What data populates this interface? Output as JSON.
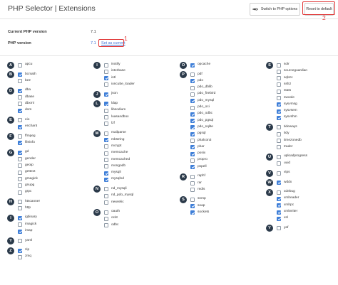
{
  "header": {
    "title": "PHP Selector | Extensions",
    "switch_label": "Switch to PHP options",
    "reset_label": "Reset to default"
  },
  "annotations": {
    "one": "1",
    "two": "2"
  },
  "info": {
    "current_label": "Current PHP version",
    "current_value": "7.1",
    "php_label": "PHP version",
    "php_value": "7.1",
    "set_current": "Set as current"
  },
  "columns": [
    [
      {
        "letter": "A",
        "items": [
          {
            "n": "apcu",
            "c": false
          }
        ]
      },
      {
        "letter": "B",
        "items": [
          {
            "n": "bcmath",
            "c": true
          },
          {
            "n": "bz2",
            "c": false
          }
        ]
      },
      {
        "letter": "D",
        "items": [
          {
            "n": "dba",
            "c": true
          },
          {
            "n": "dbase",
            "c": false
          },
          {
            "n": "dbxml",
            "c": false
          },
          {
            "n": "dom",
            "c": true
          }
        ]
      },
      {
        "letter": "E",
        "items": [
          {
            "n": "eio",
            "c": false
          },
          {
            "n": "enchant",
            "c": true
          }
        ]
      },
      {
        "letter": "F",
        "items": [
          {
            "n": "ffmpeg",
            "c": false
          },
          {
            "n": "fileinfo",
            "c": true
          }
        ]
      },
      {
        "letter": "G",
        "items": [
          {
            "n": "gd",
            "c": true
          },
          {
            "n": "gender",
            "c": false
          },
          {
            "n": "geoip",
            "c": false
          },
          {
            "n": "gettext",
            "c": false
          },
          {
            "n": "gmagick",
            "c": false
          },
          {
            "n": "gnupg",
            "c": false
          },
          {
            "n": "grpc",
            "c": false
          }
        ]
      },
      {
        "letter": "H",
        "items": [
          {
            "n": "htscanner",
            "c": false
          },
          {
            "n": "http",
            "c": false
          }
        ]
      },
      {
        "letter": "I",
        "items": [
          {
            "n": "igbinary",
            "c": true
          },
          {
            "n": "imagick",
            "c": false
          },
          {
            "n": "imap",
            "c": true
          }
        ]
      },
      {
        "letter": "Y",
        "items": [
          {
            "n": "yaml",
            "c": false
          }
        ]
      },
      {
        "letter": "Z",
        "items": [
          {
            "n": "zip",
            "c": true
          },
          {
            "n": "zmq",
            "c": false
          }
        ]
      }
    ],
    [
      {
        "letter": "I",
        "items": [
          {
            "n": "inotify",
            "c": false
          },
          {
            "n": "interbase",
            "c": false
          },
          {
            "n": "intl",
            "c": true
          },
          {
            "n": "ioncube_loader",
            "c": false
          }
        ]
      },
      {
        "letter": "J",
        "items": [
          {
            "n": "json",
            "c": true
          }
        ]
      },
      {
        "letter": "L",
        "items": [
          {
            "n": "ldap",
            "c": true
          },
          {
            "n": "libsodium",
            "c": false
          },
          {
            "n": "luasandbox",
            "c": false
          },
          {
            "n": "lzf",
            "c": false
          }
        ]
      },
      {
        "letter": "M",
        "items": [
          {
            "n": "mailparse",
            "c": false
          },
          {
            "n": "mbstring",
            "c": true
          },
          {
            "n": "mcrypt",
            "c": false
          },
          {
            "n": "memcache",
            "c": false
          },
          {
            "n": "memcached",
            "c": false
          },
          {
            "n": "mongodb",
            "c": false
          },
          {
            "n": "mysqli",
            "c": true
          },
          {
            "n": "mysqlnd",
            "c": true
          }
        ]
      },
      {
        "letter": "N",
        "items": [
          {
            "n": "nd_mysqli",
            "c": false
          },
          {
            "n": "nd_pdo_mysql",
            "c": false
          },
          {
            "n": "newrelic",
            "c": false
          }
        ]
      },
      {
        "letter": "O",
        "items": [
          {
            "n": "oauth",
            "c": false
          },
          {
            "n": "oci8",
            "c": false
          },
          {
            "n": "odbc",
            "c": false
          }
        ]
      }
    ],
    [
      {
        "letter": "O",
        "items": [
          {
            "n": "opcache",
            "c": true
          }
        ]
      },
      {
        "letter": "P",
        "items": [
          {
            "n": "pdf",
            "c": false
          },
          {
            "n": "pdo",
            "c": true
          },
          {
            "n": "pdo_dblib",
            "c": false
          },
          {
            "n": "pdo_firebird",
            "c": false
          },
          {
            "n": "pdo_mysql",
            "c": true
          },
          {
            "n": "pdo_oci",
            "c": false
          },
          {
            "n": "pdo_odbc",
            "c": true
          },
          {
            "n": "pdo_pgsql",
            "c": true
          },
          {
            "n": "pdo_sqlite",
            "c": true
          },
          {
            "n": "pgsql",
            "c": true
          },
          {
            "n": "phalcon3",
            "c": false
          },
          {
            "n": "phar",
            "c": true
          },
          {
            "n": "posix",
            "c": true
          },
          {
            "n": "propro",
            "c": false
          },
          {
            "n": "pspell",
            "c": true
          }
        ]
      },
      {
        "letter": "R",
        "items": [
          {
            "n": "raphf",
            "c": false
          },
          {
            "n": "rar",
            "c": false
          },
          {
            "n": "redis",
            "c": false
          }
        ]
      },
      {
        "letter": "S",
        "items": [
          {
            "n": "snmp",
            "c": false
          },
          {
            "n": "soap",
            "c": true
          },
          {
            "n": "sockets",
            "c": true
          }
        ]
      }
    ],
    [
      {
        "letter": "S",
        "items": [
          {
            "n": "solr",
            "c": false
          },
          {
            "n": "sourceguardian",
            "c": false
          },
          {
            "n": "sqlsrv",
            "c": false
          },
          {
            "n": "ssh2",
            "c": false
          },
          {
            "n": "stats",
            "c": false
          },
          {
            "n": "swoole",
            "c": false
          },
          {
            "n": "sysvmsg",
            "c": true
          },
          {
            "n": "sysvsem",
            "c": true
          },
          {
            "n": "sysvshm",
            "c": true
          }
        ]
      },
      {
        "letter": "T",
        "items": [
          {
            "n": "tideways",
            "c": false
          },
          {
            "n": "tidy",
            "c": false
          },
          {
            "n": "timezonedb",
            "c": false
          },
          {
            "n": "trader",
            "c": false
          }
        ]
      },
      {
        "letter": "U",
        "items": [
          {
            "n": "uploadprogress",
            "c": false
          },
          {
            "n": "uuid",
            "c": false
          }
        ]
      },
      {
        "letter": "V",
        "items": [
          {
            "n": "vips",
            "c": false
          }
        ]
      },
      {
        "letter": "W",
        "items": [
          {
            "n": "wddx",
            "c": true
          }
        ]
      },
      {
        "letter": "X",
        "items": [
          {
            "n": "xdebug",
            "c": false
          },
          {
            "n": "xmlreader",
            "c": true
          },
          {
            "n": "xmlrpc",
            "c": true
          },
          {
            "n": "xmlwriter",
            "c": true
          },
          {
            "n": "xsl",
            "c": true
          }
        ]
      },
      {
        "letter": "Y",
        "items": [
          {
            "n": "yaf",
            "c": false
          }
        ]
      }
    ]
  ]
}
